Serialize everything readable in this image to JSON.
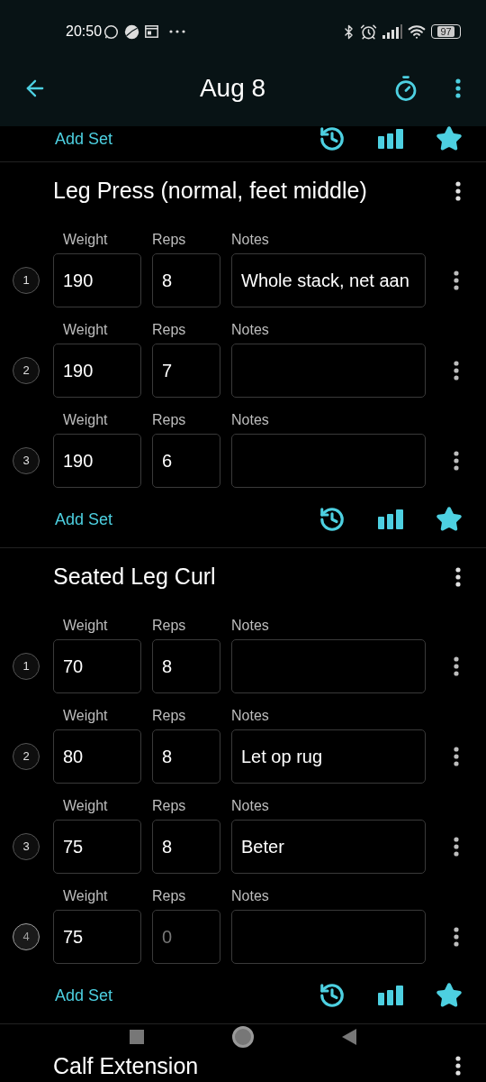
{
  "status_bar": {
    "time": "20:50",
    "battery": "97"
  },
  "app_bar": {
    "title": "Aug 8"
  },
  "previous_exercise": {
    "add_set": "Add Set"
  },
  "exercises": [
    {
      "name": "Leg Press (normal, feet middle)",
      "add_set": "Add Set",
      "sets": [
        {
          "number": "1",
          "current": false,
          "weight_label": "Weight",
          "weight": "190",
          "reps_label": "Reps",
          "reps": "8",
          "notes_label": "Notes",
          "notes": "Whole stack, net aan"
        },
        {
          "number": "2",
          "current": false,
          "weight_label": "Weight",
          "weight": "190",
          "reps_label": "Reps",
          "reps": "7",
          "notes_label": "Notes"
        },
        {
          "number": "3",
          "current": false,
          "weight_label": "Weight",
          "weight": "190",
          "reps_label": "Reps",
          "reps": "6",
          "notes_label": "Notes"
        }
      ]
    },
    {
      "name": "Seated Leg Curl",
      "add_set": "Add Set",
      "sets": [
        {
          "number": "1",
          "current": false,
          "weight_label": "Weight",
          "weight": "70",
          "reps_label": "Reps",
          "reps": "8",
          "notes_label": "Notes"
        },
        {
          "number": "2",
          "current": false,
          "weight_label": "Weight",
          "weight": "80",
          "reps_label": "Reps",
          "reps": "8",
          "notes_label": "Notes",
          "notes": "Let op rug"
        },
        {
          "number": "3",
          "current": false,
          "weight_label": "Weight",
          "weight": "75",
          "reps_label": "Reps",
          "reps": "8",
          "notes_label": "Notes",
          "notes": "Beter"
        },
        {
          "number": "4",
          "current": true,
          "weight_label": "Weight",
          "weight": "75",
          "reps_label": "Reps",
          "reps_placeholder": "0",
          "notes_label": "Notes"
        }
      ]
    }
  ],
  "next_exercise": {
    "name": "Calf Extension"
  }
}
